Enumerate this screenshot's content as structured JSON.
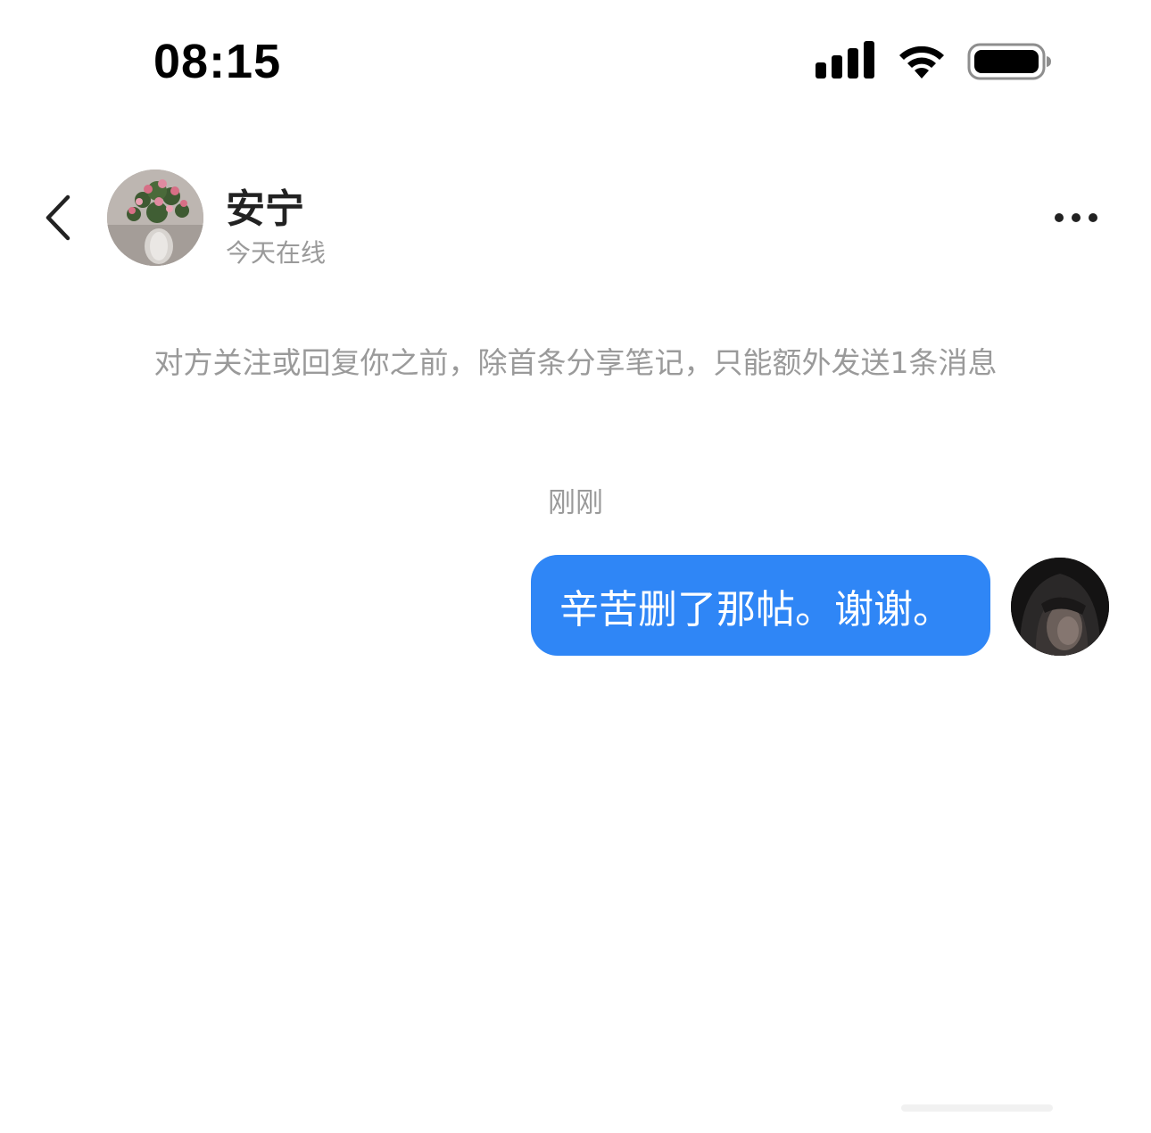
{
  "status_bar": {
    "time": "08:15"
  },
  "header": {
    "contact_name": "安宁",
    "contact_status": "今天在线"
  },
  "notice": "对方关注或回复你之前，除首条分享笔记，只能额外发送1条消息",
  "messages": [
    {
      "timestamp": "刚刚",
      "text": "辛苦删了那帖。谢谢。",
      "sender": "me"
    }
  ],
  "colors": {
    "bubble": "#2f86f6",
    "muted_text": "#9a9a9a",
    "name_text": "#222222"
  },
  "icons": [
    "signal-icon",
    "wifi-icon",
    "battery-icon",
    "back-arrow-icon",
    "more-icon"
  ]
}
